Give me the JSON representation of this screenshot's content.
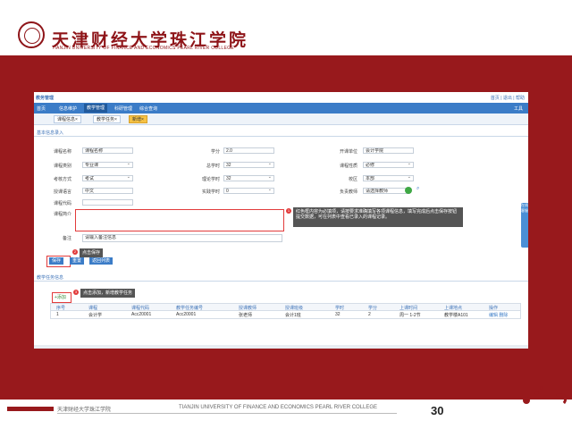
{
  "header": {
    "logo_cn": "天津财经大学珠江学院",
    "logo_en": "TIANJIN UNIVERSITY OF FINANCE AND ECONOMICS PEARL RIVER COLLEGE"
  },
  "screenshot": {
    "system_title": "教务管理",
    "user_links": "首页 | 退出 | 帮助",
    "menu": [
      "首页",
      "信息维护",
      "教学管理",
      "科研管理",
      "综合查询"
    ],
    "menu_active_index": 2,
    "menu_right": "工具",
    "tabs": [
      {
        "label": "课程信息",
        "active": false
      },
      {
        "label": "教学任务",
        "active": false
      },
      {
        "label": "新增",
        "active": true
      }
    ],
    "section1_title": "基本信息录入",
    "fields": {
      "course_name_label": "课程名称",
      "course_name_value": "课程名称",
      "credit_label": "学分",
      "credit_value": "2.0",
      "dept_label": "开课单位",
      "dept_value": "会计学院",
      "type_label": "课程类别",
      "type_value": "专业课",
      "hours_label": "总学时",
      "hours_value": "32",
      "nature_label": "课程性质",
      "nature_value": "必修",
      "exam_label": "考核方式",
      "exam_value": "考试",
      "theory_label": "理论学时",
      "theory_value": "32",
      "campus_label": "校区",
      "campus_value": "本部",
      "lang_label": "授课语言",
      "lang_value": "中文",
      "practice_label": "实践学时",
      "practice_value": "0",
      "teacher_label": "负责教师",
      "teacher_value": "请选择教师",
      "code_label": "课程代码",
      "code_value": "",
      "intro_label": "课程简介",
      "note_label": "备注",
      "note_value": "请输入备注信息"
    },
    "callout_form": "红色框内容为必填项，请按要求准确填写各项课程信息，填写完成后点击保存按钮提交数据，可在列表中查看已录入的课程记录。",
    "badge_form": "1",
    "buttons": {
      "save": "保存",
      "reset": "重置",
      "back": "返回列表"
    },
    "callout_save": "点击保存",
    "badge_save": "2",
    "section2_title": "教学任务信息",
    "grid_add_label": "+添加",
    "callout_add": "点击添加，新增教学任务",
    "badge_add": "3",
    "side_tab": "在线客服",
    "grid_headers": [
      "序号",
      "课程",
      "课程代码",
      "教学任务编号",
      "授课教师",
      "授课班级",
      "学时",
      "学分",
      "上课时间",
      "上课地点",
      "操作"
    ],
    "grid_rows": [
      [
        "1",
        "会计学",
        "Acc20001",
        "Acc20001",
        "张老师",
        "会计1班",
        "32",
        "2",
        "周一 1-2节",
        "教学楼A101",
        "编辑 删除"
      ]
    ]
  },
  "footer": {
    "cn": "天津财经大学珠江学院",
    "en": "TIANJIN UNIVERSITY OF FINANCE AND ECONOMICS PEARL RIVER COLLEGE",
    "page_number": "30"
  },
  "colors": {
    "brand": "#98191c",
    "accent": "#3b7cc7",
    "highlight": "#e23b3b"
  }
}
